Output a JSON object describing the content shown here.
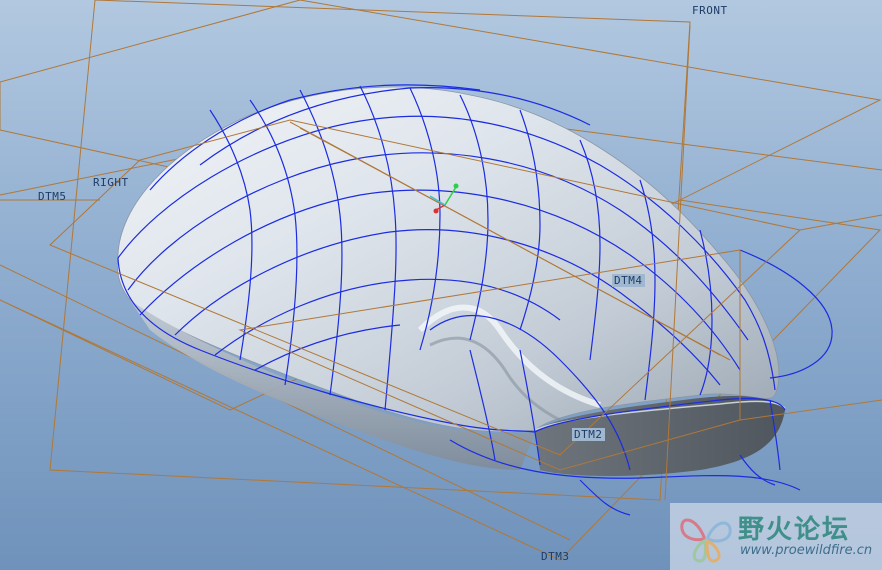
{
  "datum_planes": {
    "front": "FRONT",
    "right": "RIGHT",
    "dtm5": "DTM5",
    "dtm4": "DTM4",
    "dtm2": "DTM2",
    "dtm3": "DTM3"
  },
  "csys_axes": {
    "x_color": "#e03030",
    "y_color": "#2bd04a",
    "z_color": "#40c0d0"
  },
  "colors": {
    "datum_plane": "#b07838",
    "surface_curves": "#1c2ce0",
    "background_top": "#b2c8e0",
    "background_bottom": "#6f92bb"
  },
  "watermark": {
    "title": "野火论坛",
    "url": "www.proewildfire.cn",
    "logo_icon": "butterfly-logo"
  }
}
